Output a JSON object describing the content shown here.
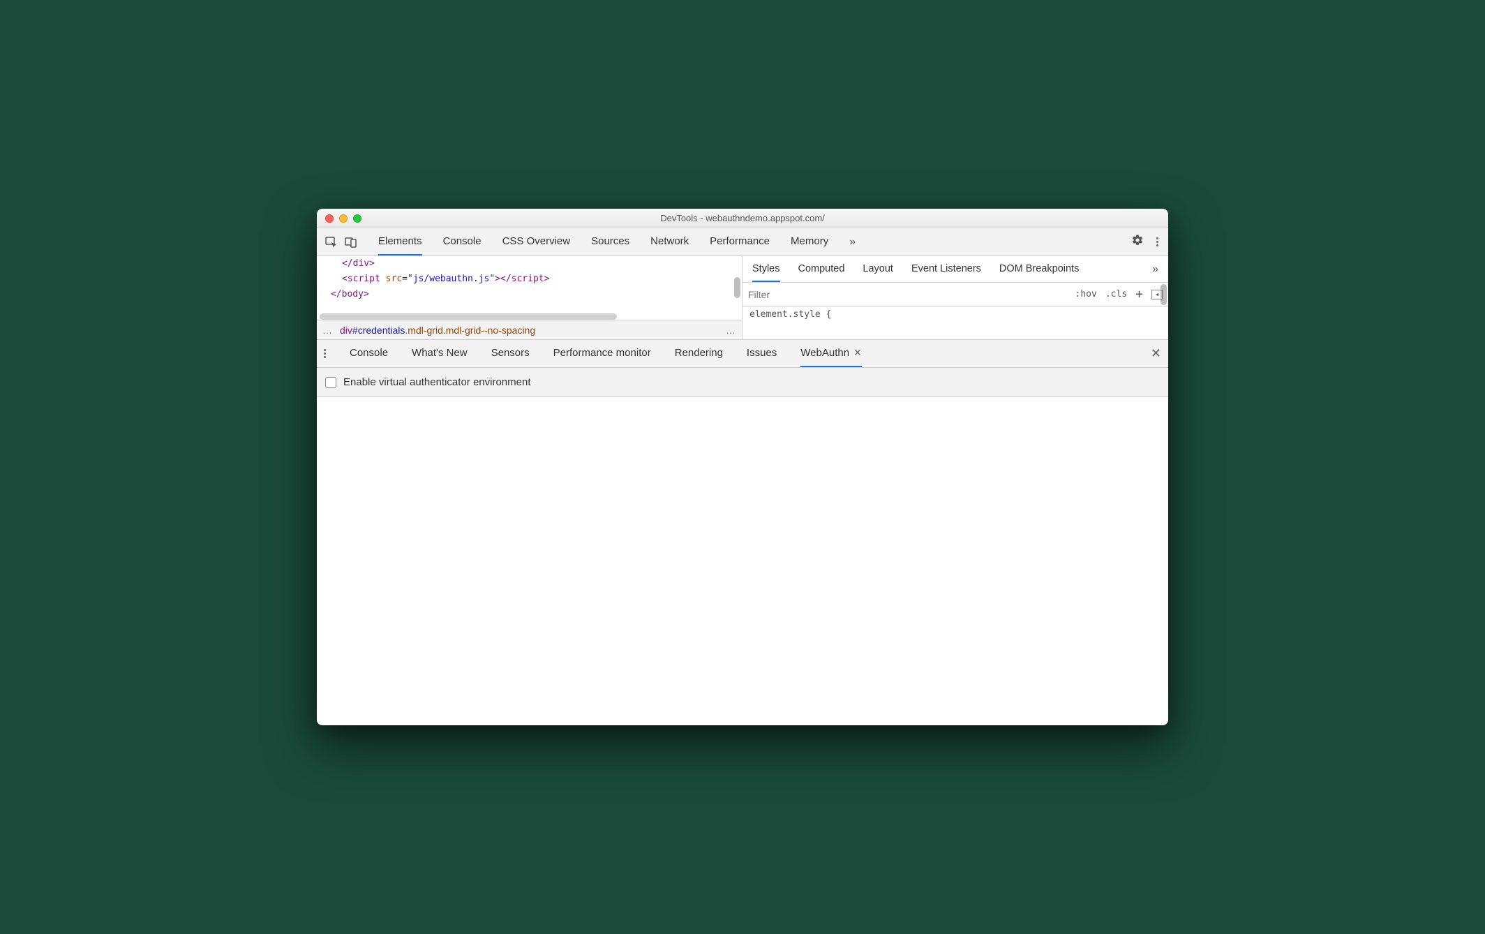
{
  "window": {
    "title": "DevTools - webauthndemo.appspot.com/"
  },
  "toolbar": {
    "tabs": [
      "Elements",
      "Console",
      "CSS Overview",
      "Sources",
      "Network",
      "Performance",
      "Memory"
    ],
    "active": "Elements"
  },
  "dom": {
    "line1_close_div": "</div>",
    "line2_script_attr": "src",
    "line2_script_val": "js/webauthn.js",
    "line3_body": "</body>"
  },
  "breadcrumb": {
    "tag": "div",
    "id": "#credentials",
    "classes": ".mdl-grid.mdl-grid--no-spacing"
  },
  "styles": {
    "tabs": [
      "Styles",
      "Computed",
      "Layout",
      "Event Listeners",
      "DOM Breakpoints"
    ],
    "active": "Styles",
    "filter_placeholder": "Filter",
    "hov": ":hov",
    "cls": ".cls",
    "element_style": "element.style {"
  },
  "drawer": {
    "tabs": [
      "Console",
      "What's New",
      "Sensors",
      "Performance monitor",
      "Rendering",
      "Issues",
      "WebAuthn"
    ],
    "active": "WebAuthn"
  },
  "webauthn": {
    "enable_label": "Enable virtual authenticator environment"
  }
}
